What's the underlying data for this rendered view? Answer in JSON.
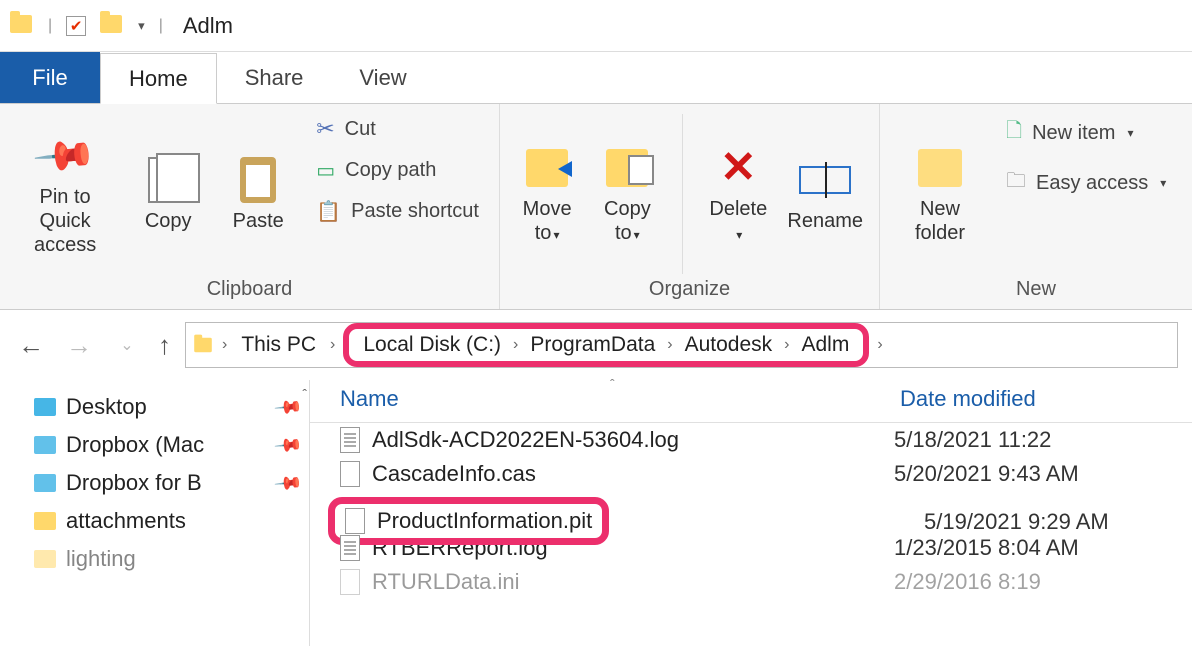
{
  "window": {
    "title": "Adlm"
  },
  "tabs": {
    "file": "File",
    "home": "Home",
    "share": "Share",
    "view": "View"
  },
  "ribbon": {
    "clipboard": {
      "label": "Clipboard",
      "pin": "Pin to Quick access",
      "copy": "Copy",
      "paste": "Paste",
      "cut": "Cut",
      "copy_path": "Copy path",
      "paste_shortcut": "Paste shortcut"
    },
    "organize": {
      "label": "Organize",
      "move_to": "Move to",
      "copy_to": "Copy to",
      "delete": "Delete",
      "rename": "Rename"
    },
    "new": {
      "label": "New",
      "new_folder": "New folder",
      "new_item": "New item",
      "easy_access": "Easy access"
    }
  },
  "address": {
    "segments": [
      "This PC",
      "Local Disk (C:)",
      "ProgramData",
      "Autodesk",
      "Adlm"
    ]
  },
  "sidebar": {
    "items": [
      {
        "label": "Desktop",
        "pinned": true,
        "color": "blue"
      },
      {
        "label": "Dropbox (Mac",
        "pinned": true,
        "color": "blue2"
      },
      {
        "label": "Dropbox for B",
        "pinned": true,
        "color": "blue2"
      },
      {
        "label": "attachments",
        "pinned": false,
        "color": "yellow"
      },
      {
        "label": "lighting",
        "pinned": false,
        "color": "yellow"
      }
    ]
  },
  "columns": {
    "name": "Name",
    "date": "Date modified"
  },
  "files": [
    {
      "name": "AdlSdk-ACD2022EN-53604.log",
      "date": "5/18/2021 11:22",
      "icon": "lines"
    },
    {
      "name": "CascadeInfo.cas",
      "date": "5/20/2021 9:43 AM",
      "icon": "blank"
    },
    {
      "name": "ProductInformation.pit",
      "date": "5/19/2021 9:29 AM",
      "icon": "blank",
      "highlight": true
    },
    {
      "name": "RTBERReport.log",
      "date": "1/23/2015 8:04 AM",
      "icon": "lines"
    },
    {
      "name": "RTURLData.ini",
      "date": "2/29/2016 8:19",
      "icon": "blank"
    }
  ]
}
